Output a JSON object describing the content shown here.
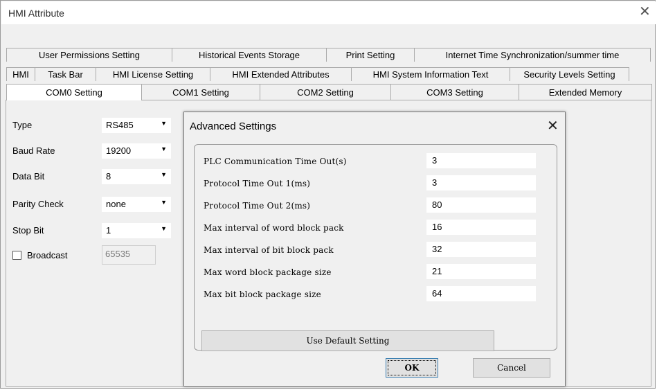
{
  "window": {
    "title": "HMI Attribute",
    "close_glyph": "✕"
  },
  "tabs": {
    "row1": [
      "User Permissions Setting",
      "Historical Events Storage",
      "Print Setting",
      "Internet Time Synchronization/summer time"
    ],
    "row2": [
      "HMI",
      "Task Bar",
      "HMI License Setting",
      "HMI Extended Attributes",
      "HMI System Information Text",
      "Security Levels Setting"
    ],
    "row3": [
      "COM0 Setting",
      "COM1 Setting",
      "COM2 Setting",
      "COM3 Setting",
      "Extended Memory"
    ],
    "active": "COM0 Setting"
  },
  "com_settings": {
    "type": {
      "label": "Type",
      "value": "RS485"
    },
    "baud_rate": {
      "label": "Baud Rate",
      "value": "19200"
    },
    "data_bit": {
      "label": "Data Bit",
      "value": "8"
    },
    "parity_check": {
      "label": "Parity Check",
      "value": "none"
    },
    "stop_bit": {
      "label": "Stop Bit",
      "value": "1"
    },
    "broadcast": {
      "label": "Broadcast",
      "checked": false,
      "value": "65535"
    }
  },
  "advanced": {
    "title": "Advanced Settings",
    "rows": [
      {
        "label": "PLC Communication Time Out(s)",
        "value": "3"
      },
      {
        "label": "Protocol Time Out 1(ms)",
        "value": "3"
      },
      {
        "label": "Protocol Time Out 2(ms)",
        "value": "80"
      },
      {
        "label": "Max interval of word block pack",
        "value": "16"
      },
      {
        "label": "Max interval of bit block pack",
        "value": "32"
      },
      {
        "label": "Max word block package size",
        "value": "21"
      },
      {
        "label": "Max bit block package size",
        "value": "64"
      }
    ],
    "default_button": "Use Default Setting",
    "ok_button": "OK",
    "cancel_button": "Cancel"
  }
}
